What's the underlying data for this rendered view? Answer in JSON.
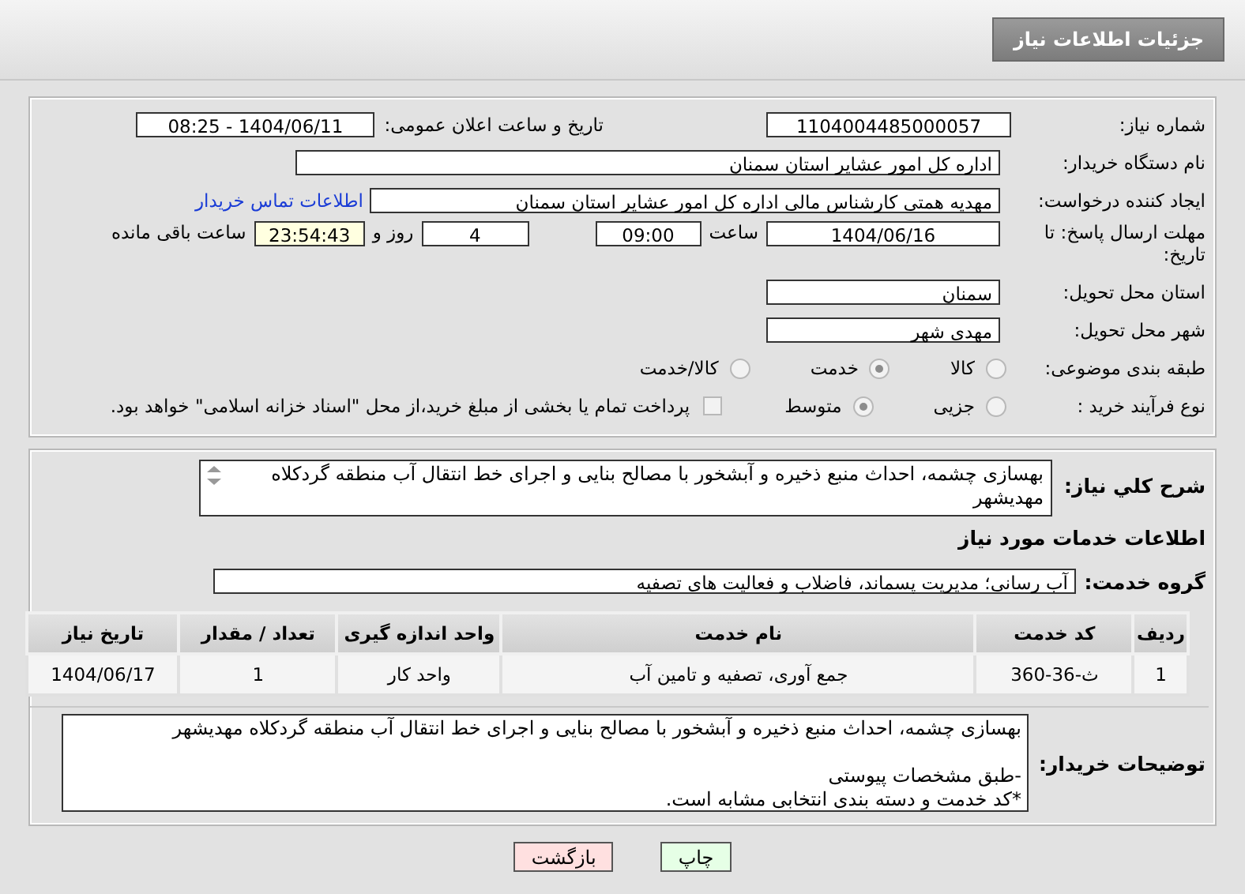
{
  "header": {
    "title": "جزئیات اطلاعات نیاز"
  },
  "need_number": {
    "label": "شماره نیاز:",
    "value": "1104004485000057"
  },
  "announce": {
    "label": "تاریخ و ساعت اعلان عمومی:",
    "value": "1404/06/11 - 08:25"
  },
  "buyer_org": {
    "label": "نام دستگاه خریدار:",
    "value": "اداره کل امور عشایر استان سمنان"
  },
  "requester": {
    "label": "ایجاد کننده درخواست:",
    "value": "مهدیه همتی کارشناس مالی اداره کل امور عشایر استان سمنان",
    "contact_link": "اطلاعات تماس خریدار"
  },
  "deadline": {
    "label": "مهلت ارسال پاسخ: تا تاریخ:",
    "date": "1404/06/16",
    "time_label": "ساعت",
    "time": "09:00",
    "days": "4",
    "days_label": "روز و",
    "remaining": "23:54:43",
    "remaining_label": "ساعت باقی مانده"
  },
  "province": {
    "label": "استان محل تحویل:",
    "value": "سمنان"
  },
  "city": {
    "label": "شهر محل تحویل:",
    "value": "مهدی شهر"
  },
  "category": {
    "label": "طبقه بندی موضوعی:",
    "options": [
      {
        "label": "کالا",
        "selected": false
      },
      {
        "label": "خدمت",
        "selected": true
      },
      {
        "label": "کالا/خدمت",
        "selected": false
      }
    ]
  },
  "purchase_type": {
    "label": "نوع فرآیند خرید :",
    "options": [
      {
        "label": "جزیی",
        "selected": false
      },
      {
        "label": "متوسط",
        "selected": true
      }
    ],
    "payment": {
      "checked": false,
      "text": "پرداخت تمام یا بخشی از مبلغ خرید،از محل \"اسناد خزانه اسلامی\" خواهد بود."
    }
  },
  "description": {
    "label": "شرح كلي نياز:",
    "value": "بهسازی چشمه، احداث منبع ذخیره و آبشخور با مصالح بنایی و اجرای خط انتقال آب منطقه گردکلاه مهدیشهر"
  },
  "services": {
    "title": "اطلاعات خدمات مورد نياز",
    "group_label": "گروه خدمت:",
    "group_value": "آب رسانی؛ مدیریت پسماند، فاضلاب و فعالیت های تصفیه"
  },
  "table": {
    "columns": [
      "ردیف",
      "کد خدمت",
      "نام خدمت",
      "واحد اندازه گیری",
      "تعداد / مقدار",
      "تاریخ نیاز"
    ],
    "rows": [
      [
        "1",
        "ث-36-360",
        "جمع آوری، تصفیه و تامین آب",
        "واحد کار",
        "1",
        "1404/06/17"
      ]
    ]
  },
  "buyer_notes": {
    "label": "توضیحات خریدار:",
    "paragraphs": [
      [
        "بهسازی چشمه، احداث منبع ذخیره و آبشخور با مصالح بنایی و اجرای خط انتقال آب منطقه گردکلاه مهدیشهر"
      ],
      [
        "-طبق مشخصات پیوستی",
        "*کد خدمت و دسته بندی انتخابی مشابه است."
      ]
    ]
  },
  "buttons": [
    {
      "kind": "print",
      "label": "چاپ"
    },
    {
      "kind": "back",
      "label": "بازگشت"
    }
  ]
}
